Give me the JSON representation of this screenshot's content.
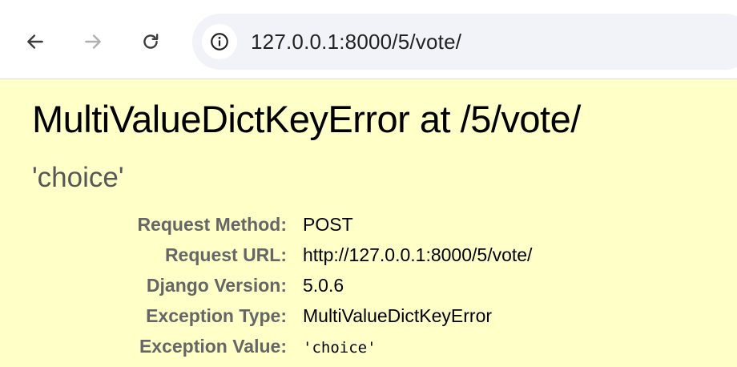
{
  "browser": {
    "url": "127.0.0.1:8000/5/vote/",
    "icons": {
      "back": "arrow-left-icon",
      "forward": "arrow-right-icon",
      "reload": "reload-icon",
      "site_info": "info-icon"
    }
  },
  "page": {
    "title": "MultiValueDictKeyError at /5/vote/",
    "subtitle": "'choice'",
    "meta": [
      {
        "label": "Request Method:",
        "value": "POST"
      },
      {
        "label": "Request URL:",
        "value": "http://127.0.0.1:8000/5/vote/"
      },
      {
        "label": "Django Version:",
        "value": "5.0.6"
      },
      {
        "label": "Exception Type:",
        "value": "MultiValueDictKeyError"
      },
      {
        "label": "Exception Value:",
        "value": "'choice'"
      }
    ]
  },
  "colors": {
    "background": "#ffffc8",
    "label": "#666666",
    "subtitle": "#575757"
  }
}
